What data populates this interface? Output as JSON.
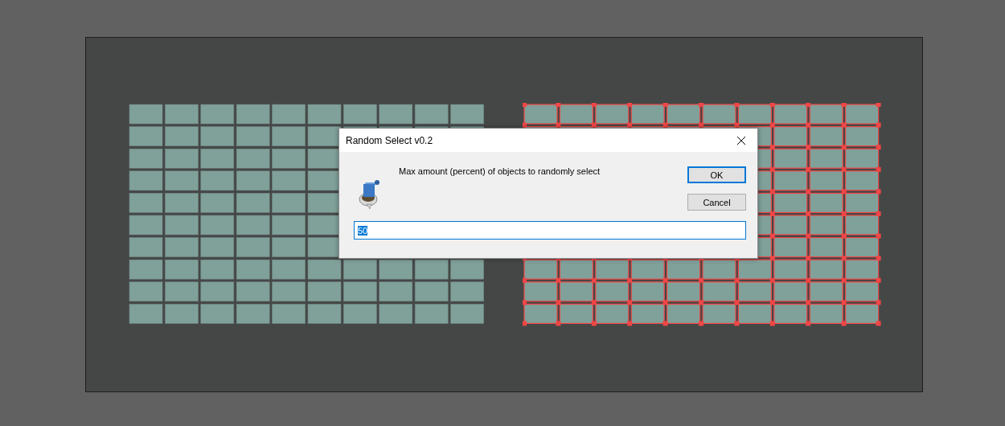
{
  "artboard": {
    "grids": [
      {
        "selected": false
      },
      {
        "selected": true
      }
    ]
  },
  "dialog": {
    "title": "Random Select v0.2",
    "message": "Max amount (percent) of objects to randomly select",
    "input": {
      "value": "50",
      "text_selected": true
    },
    "buttons": [
      {
        "label": "OK",
        "default": true
      },
      {
        "label": "Cancel",
        "default": false
      }
    ]
  }
}
